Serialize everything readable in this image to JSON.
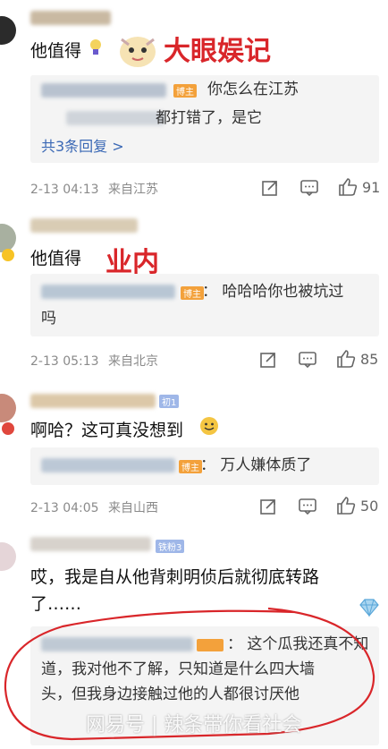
{
  "watermarks": {
    "top": "大眼娱记",
    "middle": "业内",
    "bottom": "网易号 | 辣条带你看社会"
  },
  "comments": [
    {
      "text": "他值得",
      "reply_prefix": "： ",
      "reply_line1": "你怎么在江苏",
      "reply_line2": "都打错了，是它",
      "more_replies": "共3条回复 >",
      "time": "2-13 04:13",
      "location": "来自江苏",
      "likes": "91",
      "badge": "博主"
    },
    {
      "text": "他值得",
      "reply_line1": "： 哈哈哈你也被坑过",
      "reply_line2": "吗",
      "time": "2-13 05:13",
      "location": "来自北京",
      "likes": "85",
      "badge": "博主"
    },
    {
      "text": "啊哈？这可真没想到",
      "reply_line1": "： 万人嫌体质了",
      "time": "2-13 04:05",
      "location": "来自山西",
      "likes": "50",
      "badge": "博主",
      "fan_badge": "初1"
    },
    {
      "text_line1": "哎，我是自从他背刺明侦后就彻底转路",
      "text_line2": "了……",
      "reply_line1": "： 这个瓜我还真不知",
      "reply_line2": "道，我对他不了解，只知道是什么四大墙",
      "reply_line3": "头，但我身边接触过他的人都很讨厌他",
      "fan_badge": "铁粉3"
    }
  ],
  "colors": {
    "link": "#3a68b5",
    "annotation": "#d9262a",
    "badge": "#f3a13b"
  }
}
